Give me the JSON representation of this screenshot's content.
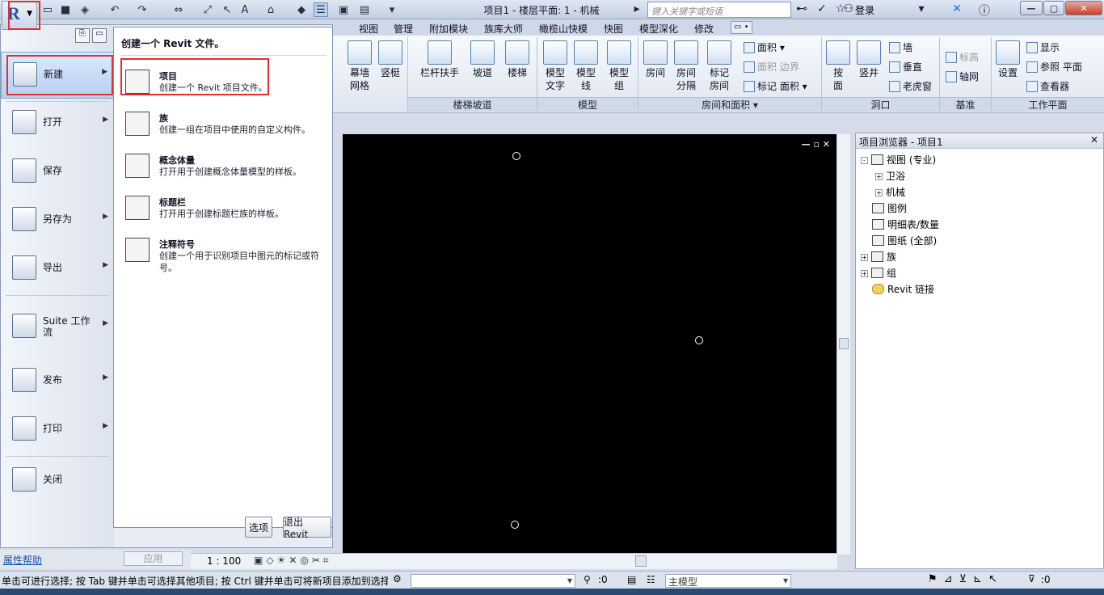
{
  "titlebar": {
    "doc_title": "项目1 - 楼层平面: 1 - 机械",
    "search_placeholder": "键入关键字或短语",
    "login": "登录",
    "icons": [
      "save-icon",
      "undo-icon",
      "redo-icon",
      "measure-icon",
      "text-icon",
      "binoculars-icon",
      "star-icon",
      "user-icon",
      "exchange-icon",
      "help-icon"
    ]
  },
  "tabs": [
    "视图",
    "管理",
    "附加模块",
    "族库大师",
    "橄榄山快模",
    "快图",
    "模型深化",
    "修改"
  ],
  "ribbon": {
    "curtain_grid": "幕墙\n网格",
    "mullion": "竖梃",
    "railing": "栏杆扶手",
    "ramp": "坡道",
    "stair": "楼梯",
    "model_text": "模型\n文字",
    "model_line": "模型\n线",
    "model_group": "模型\n组",
    "room": "房间",
    "room_sep": "房间\n分隔",
    "tag_room": "标记\n房间",
    "area": "面积",
    "area_boundary": "面积  边界",
    "tag": "标记",
    "area2": "面积",
    "by_face": "按\n面",
    "shaft": "竖井",
    "wall": "墙",
    "vertical": "垂直",
    "dormer": "老虎窗",
    "level": "标高",
    "grid": "轴网",
    "set": "设置",
    "show": "显示",
    "ref_plane": "参照 平面",
    "viewer": "查看器",
    "groups": {
      "circulation": "楼梯坡道",
      "model": "模型",
      "room_area": "房间和面积",
      "opening": "洞口",
      "datum": "基准",
      "workplane": "工作平面"
    }
  },
  "app_menu": {
    "left_items": [
      {
        "label": "新建",
        "icon": "new-doc-icon"
      },
      {
        "label": "打开",
        "icon": "open-folder-icon"
      },
      {
        "label": "保存",
        "icon": "save-icon"
      },
      {
        "label": "另存为",
        "icon": "save-as-icon"
      },
      {
        "label": "导出",
        "icon": "export-icon"
      },
      {
        "label": "Suite 工作\n流",
        "icon": "suite-workflow-icon"
      },
      {
        "label": "发布",
        "icon": "publish-icon"
      },
      {
        "label": "打印",
        "icon": "printer-icon"
      },
      {
        "label": "关闭",
        "icon": "close-doc-icon"
      }
    ],
    "header": "创建一个 Revit 文件。",
    "new_items": [
      {
        "title": "项目",
        "desc": "创建一个 Revit 项目文件。"
      },
      {
        "title": "族",
        "desc": "创建一组在项目中使用的自定义构件。"
      },
      {
        "title": "概念体量",
        "desc": "打开用于创建概念体量模型的样板。"
      },
      {
        "title": "标题栏",
        "desc": "打开用于创建标题栏族的样板。"
      },
      {
        "title": "注释符号",
        "desc": "创建一个用于识别项目中图元的标记或符号。"
      }
    ],
    "options_button": "选项",
    "exit_button": "退出 Revit"
  },
  "browser": {
    "title": "项目浏览器 - 项目1",
    "tree": [
      {
        "label": "视图 (专业)",
        "level": 0,
        "toggle": "-"
      },
      {
        "label": "卫浴",
        "level": 1,
        "toggle": "+"
      },
      {
        "label": "机械",
        "level": 1,
        "toggle": "+"
      },
      {
        "label": "图例",
        "level": 0,
        "toggle": ""
      },
      {
        "label": "明细表/数量",
        "level": 0,
        "toggle": ""
      },
      {
        "label": "图纸 (全部)",
        "level": 0,
        "toggle": ""
      },
      {
        "label": "族",
        "level": 0,
        "toggle": "+"
      },
      {
        "label": "组",
        "level": 0,
        "toggle": "+"
      },
      {
        "label": "Revit 链接",
        "level": 0,
        "toggle": ""
      }
    ]
  },
  "props_footer": {
    "help_link": "属性帮助",
    "apply_button": "应用"
  },
  "view_bar": {
    "scale": "1 : 100"
  },
  "status": {
    "hint": "单击可进行选择; 按 Tab 键并单击可选择其他项目; 按 Ctrl 键并单击可将新项目添加到选择",
    "selection_count": ":0",
    "model": "主模型",
    "filter_count": ":0"
  }
}
